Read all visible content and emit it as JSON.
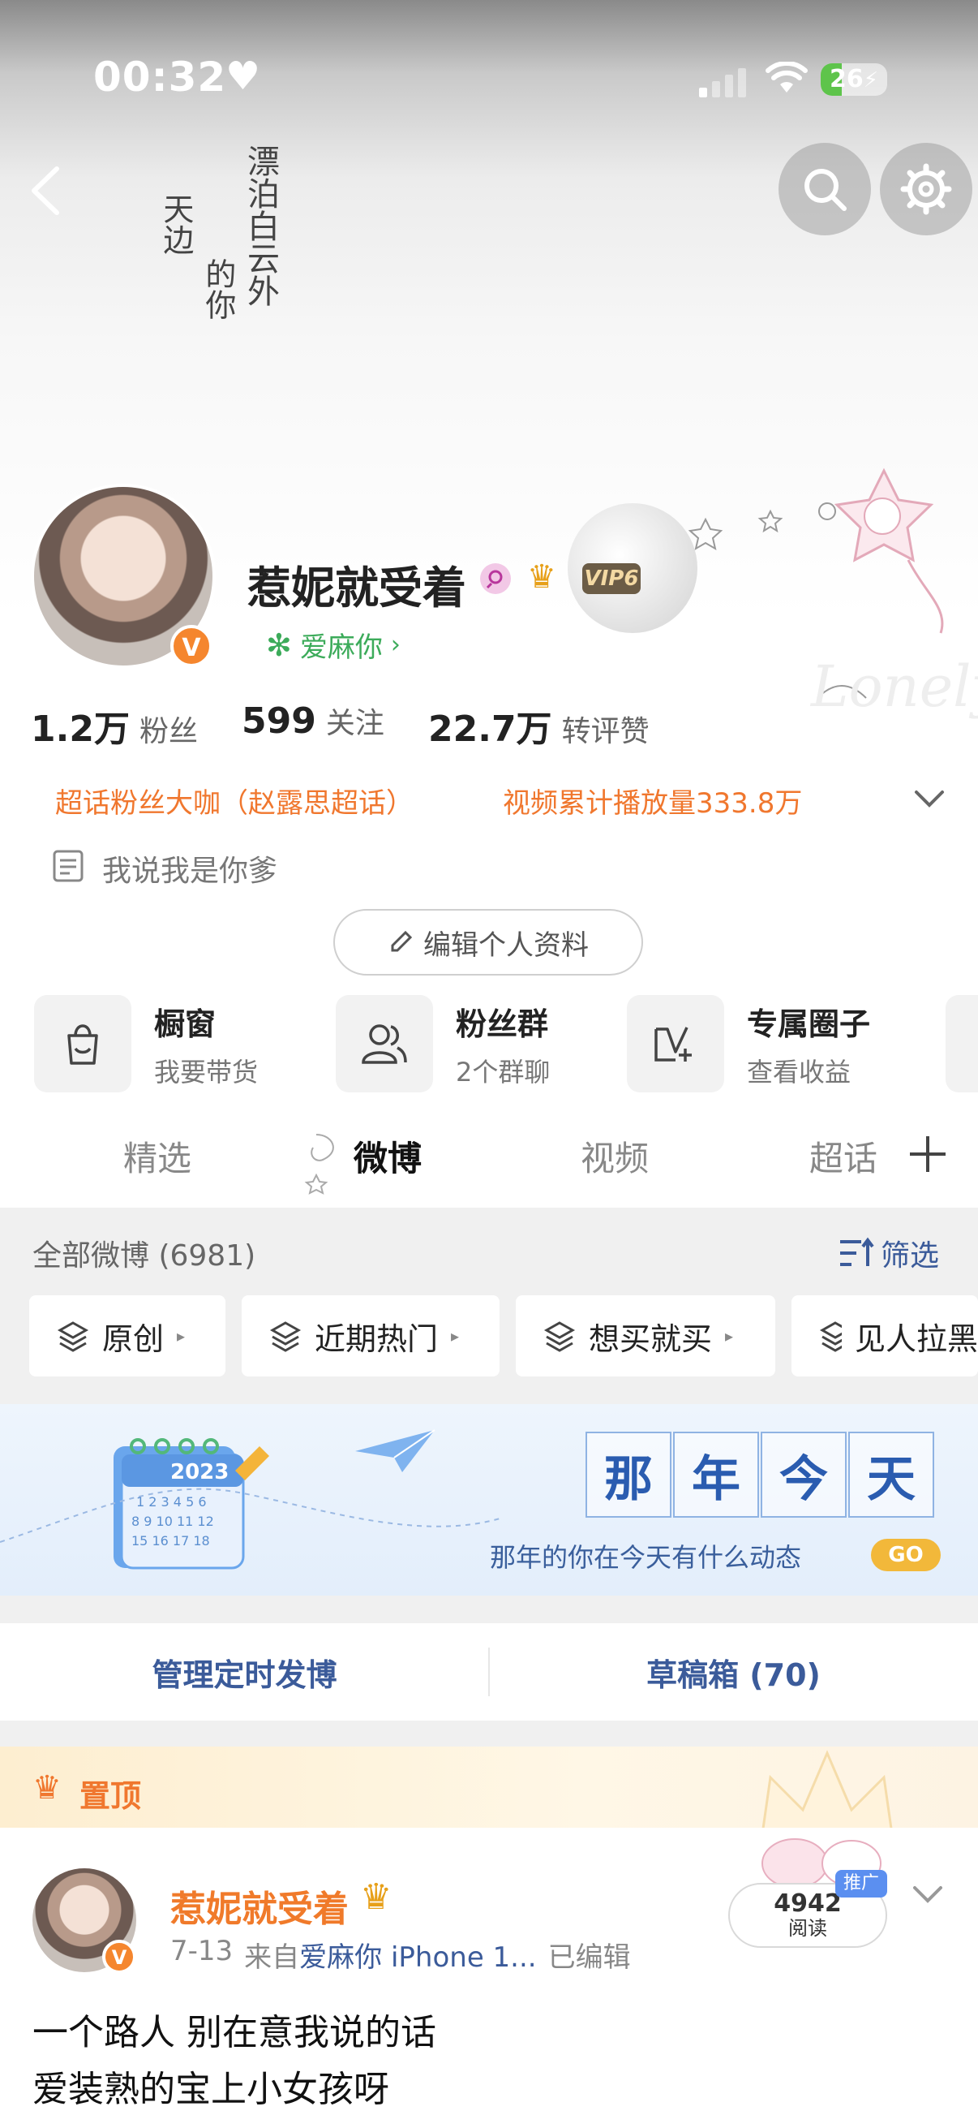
{
  "status_bar": {
    "time": "00:32",
    "battery": "26"
  },
  "header": {
    "calligraphy_lines": [
      "漂泊白云外",
      "的你",
      "天边"
    ]
  },
  "profile": {
    "name": "惹妮就受着",
    "vip_label": "VIP6",
    "verify_badge": "V",
    "sub_tag": "爱麻你",
    "stats": [
      {
        "num": "1.2万",
        "label": "粉丝"
      },
      {
        "num": "599",
        "label": "关注"
      },
      {
        "num": "22.7万",
        "label": "转评赞"
      }
    ],
    "badges": [
      "超话粉丝大咖（赵露思超话）",
      "视频累计播放量333.8万"
    ],
    "bio": "我说我是你爹",
    "edit_button": "编辑个人资料"
  },
  "features": [
    {
      "title": "橱窗",
      "sub": "我要带货",
      "icon": "shopping-bag-icon"
    },
    {
      "title": "粉丝群",
      "sub": "2个群聊",
      "icon": "group-icon"
    },
    {
      "title": "专属圈子",
      "sub": "查看收益",
      "icon": "circle-v-plus-icon"
    }
  ],
  "tabs": [
    "精选",
    "微博",
    "视频",
    "超话"
  ],
  "feed_header": {
    "count_label": "全部微博 (6981)",
    "filter_label": "筛选"
  },
  "chips": [
    "原创",
    "近期热门",
    "想买就买",
    "见人拉黑"
  ],
  "banner": {
    "calendar_year": "2023",
    "title_chars": [
      "那",
      "年",
      "今",
      "天"
    ],
    "subtitle": "那年的你在今天有什么动态",
    "go_label": "GO"
  },
  "manage": {
    "left": "管理定时发博",
    "right": "草稿箱 (70)"
  },
  "pinned": {
    "label": "置顶",
    "promo_tag": "推广",
    "read_count": "4942",
    "read_label": "阅读"
  },
  "post": {
    "author": "惹妮就受着",
    "date": "7-13",
    "from_prefix": "来自",
    "source": "爱麻你 iPhone 1...",
    "edited": "已编辑",
    "lines": [
      "一个路人 别在意我说的话",
      "爱装熟的宝上小女孩呀"
    ]
  },
  "colors": {
    "accent_orange": "#f0772e",
    "link_blue": "#3b5b9a",
    "green": "#3cab5a"
  }
}
